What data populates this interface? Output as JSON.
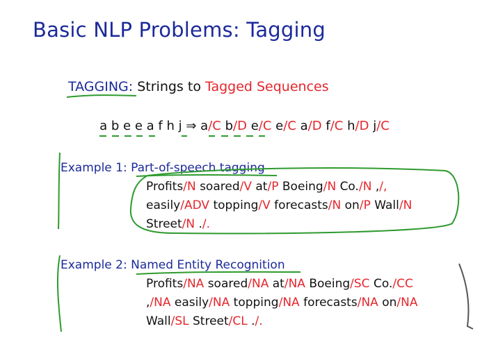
{
  "slide": {
    "title": "Basic NLP Problems: Tagging",
    "tagging_keyword": "TAGGING",
    "tagging_colon": ":",
    "tagging_middle": " Strings to ",
    "tagging_target": "Tagged Sequences",
    "example_input": "a b e e a f h j",
    "arrow": "⇒",
    "example_output": [
      {
        "w": "a",
        "t": "C"
      },
      {
        "w": "b",
        "t": "D"
      },
      {
        "w": "e",
        "t": "C"
      },
      {
        "w": "e",
        "t": "C"
      },
      {
        "w": "a",
        "t": "D"
      },
      {
        "w": "f",
        "t": "C"
      },
      {
        "w": "h",
        "t": "D"
      },
      {
        "w": "j",
        "t": "C"
      }
    ],
    "example1": {
      "prefix": "Example 1:",
      "name": "Part-of-speech tagging",
      "lines": [
        [
          {
            "w": "Profits",
            "t": "N"
          },
          {
            "w": "soared",
            "t": "V"
          },
          {
            "w": "at",
            "t": "P"
          },
          {
            "w": "Boeing",
            "t": "N"
          },
          {
            "w": "Co.",
            "t": "N"
          },
          {
            "w": ",",
            "t": ","
          }
        ],
        [
          {
            "w": "easily",
            "t": "ADV"
          },
          {
            "w": "topping",
            "t": "V"
          },
          {
            "w": "forecasts",
            "t": "N"
          },
          {
            "w": "on",
            "t": "P"
          },
          {
            "w": "Wall",
            "t": "N"
          }
        ],
        [
          {
            "w": "Street",
            "t": "N"
          },
          {
            "w": ".",
            "t": "."
          }
        ]
      ]
    },
    "example2": {
      "prefix": "Example 2:",
      "name": "Named Entity Recognition",
      "lines": [
        [
          {
            "w": "Profits",
            "t": "NA"
          },
          {
            "w": "soared",
            "t": "NA"
          },
          {
            "w": "at",
            "t": "NA"
          },
          {
            "w": "Boeing",
            "t": "SC"
          },
          {
            "w": "Co.",
            "t": "CC"
          }
        ],
        [
          {
            "w": ",",
            "t": "NA"
          },
          {
            "w": "easily",
            "t": "NA"
          },
          {
            "w": "topping",
            "t": "NA"
          },
          {
            "w": "forecasts",
            "t": "NA"
          },
          {
            "w": "on",
            "t": "NA"
          }
        ],
        [
          {
            "w": "Wall",
            "t": "SL"
          },
          {
            "w": "Street",
            "t": "CL"
          },
          {
            "w": ".",
            "t": "."
          }
        ]
      ]
    }
  }
}
